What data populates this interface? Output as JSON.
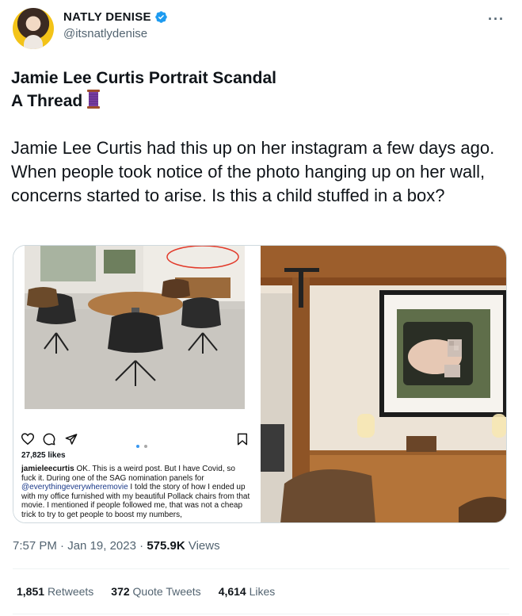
{
  "author": {
    "name": "NATLY DENISE",
    "handle": "@itsnatlydenise"
  },
  "tweet": {
    "title_line1": "Jamie Lee Curtis Portrait Scandal",
    "title_line2": "A Thread",
    "body": "Jamie Lee Curtis had this up on her instagram a few days ago. When people took notice of the photo hanging up on her wall, concerns started to arise. Is this a child stuffed in a box?",
    "time": "7:57 PM",
    "date": "Jan 19, 2023",
    "views_count": "575.9K",
    "views_label": "Views"
  },
  "instagram": {
    "likes": "27,825 likes",
    "caption_user": "jamieleecurtis",
    "caption_part1": " OK. This is a weird post. But I have Covid, so fuck it. During one of the SAG nomination panels for ",
    "caption_mention": "@everythingeverywheremovie",
    "caption_part2": " I told the story of how I ended up with my office furnished with my beautiful Pollack chairs from that movie. I mentioned if people followed me, that was not a cheap trick to try to get people to boost my numbers,"
  },
  "stats": {
    "retweets_count": "1,851",
    "retweets_label": "Retweets",
    "quotes_count": "372",
    "quotes_label": "Quote Tweets",
    "likes_count": "4,614",
    "likes_label": "Likes"
  },
  "colors": {
    "verified": "#1d9bf0",
    "secondary_text": "#536471",
    "ig_mention": "#1b3a8a"
  },
  "icons": [
    "verified-badge-icon",
    "more-icon",
    "spool-emoji-icon",
    "ig-heart-icon",
    "ig-comment-icon",
    "ig-share-icon",
    "ig-bookmark-icon"
  ]
}
